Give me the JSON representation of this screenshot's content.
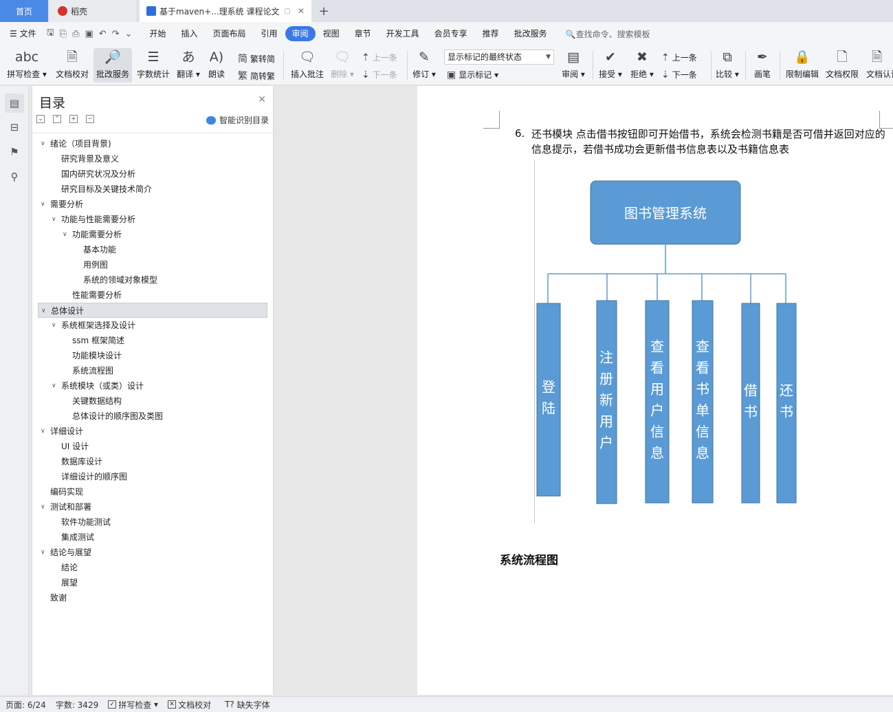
{
  "tabs": {
    "home": "首页",
    "daoke": "稻壳",
    "doc": "基于maven+...理系统 课程论文",
    "close_glyph": "✕",
    "add_glyph": "+"
  },
  "menu": {
    "file": "文件",
    "items": [
      "开始",
      "插入",
      "页面布局",
      "引用",
      "审阅",
      "视图",
      "章节",
      "开发工具",
      "会员专享",
      "推荐",
      "批改服务"
    ],
    "active": "审阅",
    "search": "查找命令、搜索模板"
  },
  "ribbon": {
    "spell": "拼写检查",
    "proofread": "文档校对",
    "correct_service": "批改服务",
    "wordcount": "字数统计",
    "translate": "翻译",
    "read_aloud": "朗读",
    "trad": "繁转简",
    "simp": "简转繁",
    "insert_comment": "插入批注",
    "delete": "删除",
    "prev": "上一条",
    "next": "下一条",
    "revise": "修订",
    "markup_state": "显示标记的最终状态",
    "show_markup": "显示标记",
    "review": "审阅",
    "accept": "接受",
    "reject": "拒绝",
    "prev2": "上一条",
    "next2": "下一条",
    "compare": "比较",
    "pen": "画笔",
    "restrict": "限制编辑",
    "doc_perm": "文档权限",
    "doc_cert": "文档认证"
  },
  "toc": {
    "title": "目录",
    "smart": "智能识别目录",
    "items": [
      {
        "text": "绪论（项目背景)",
        "level": 0,
        "chev": true
      },
      {
        "text": "研究背景及意义",
        "level": 1
      },
      {
        "text": "国内研究状况及分析",
        "level": 1
      },
      {
        "text": "研究目标及关键技术简介",
        "level": 1
      },
      {
        "text": "需要分析",
        "level": 0,
        "chev": true
      },
      {
        "text": "功能与性能需要分析",
        "level": 1,
        "chev": true
      },
      {
        "text": "功能需要分析",
        "level": 2,
        "chev": true
      },
      {
        "text": "基本功能",
        "level": 3
      },
      {
        "text": "用例图",
        "level": 3
      },
      {
        "text": "系统的领域对象模型",
        "level": 3
      },
      {
        "text": "性能需要分析",
        "level": 2
      },
      {
        "text": "总体设计",
        "level": 0,
        "chev": true,
        "selected": true
      },
      {
        "text": "系统框架选择及设计",
        "level": 1,
        "chev": true
      },
      {
        "text": "ssm 框架简述",
        "level": 2
      },
      {
        "text": "功能模块设计",
        "level": 2
      },
      {
        "text": "系统流程图",
        "level": 2
      },
      {
        "text": "系统模块（或类）设计",
        "level": 1,
        "chev": true
      },
      {
        "text": "关键数据结构",
        "level": 2
      },
      {
        "text": "总体设计的顺序图及类图",
        "level": 2
      },
      {
        "text": "详细设计",
        "level": 0,
        "chev": true
      },
      {
        "text": "UI 设计",
        "level": 1
      },
      {
        "text": "数据库设计",
        "level": 1
      },
      {
        "text": "详细设计的顺序图",
        "level": 1
      },
      {
        "text": "编码实现",
        "level": 0
      },
      {
        "text": "测试和部署",
        "level": 0,
        "chev": true
      },
      {
        "text": "软件功能测试",
        "level": 1
      },
      {
        "text": "集成测试",
        "level": 1
      },
      {
        "text": "结论与展望",
        "level": 0,
        "chev": true
      },
      {
        "text": "结论",
        "level": 1
      },
      {
        "text": "展望",
        "level": 1
      },
      {
        "text": "致谢",
        "level": 0
      }
    ]
  },
  "document": {
    "item_number": "6.",
    "paragraph": "还书模块 点击借书按钮即可开始借书，系统会检测书籍是否可借并返回对应的信息提示，若借书成功会更新借书信息表以及书籍信息表",
    "diagram_root": "图书管理系统",
    "diagram_modules": [
      "登陆",
      "注册新用户",
      "查看用户信息",
      "查看书单信息",
      "借书",
      "还书"
    ],
    "caption": "系统流程图",
    "colors": {
      "box_fill": "#5b9bd5",
      "box_stroke": "#41719c",
      "line": "#5b9bd5",
      "label": "#ffffff"
    }
  },
  "status": {
    "page": "页面: 6/24",
    "words": "字数: 3429",
    "spell": "拼写检查",
    "proof": "文档校对",
    "missing_font": "缺失字体"
  }
}
